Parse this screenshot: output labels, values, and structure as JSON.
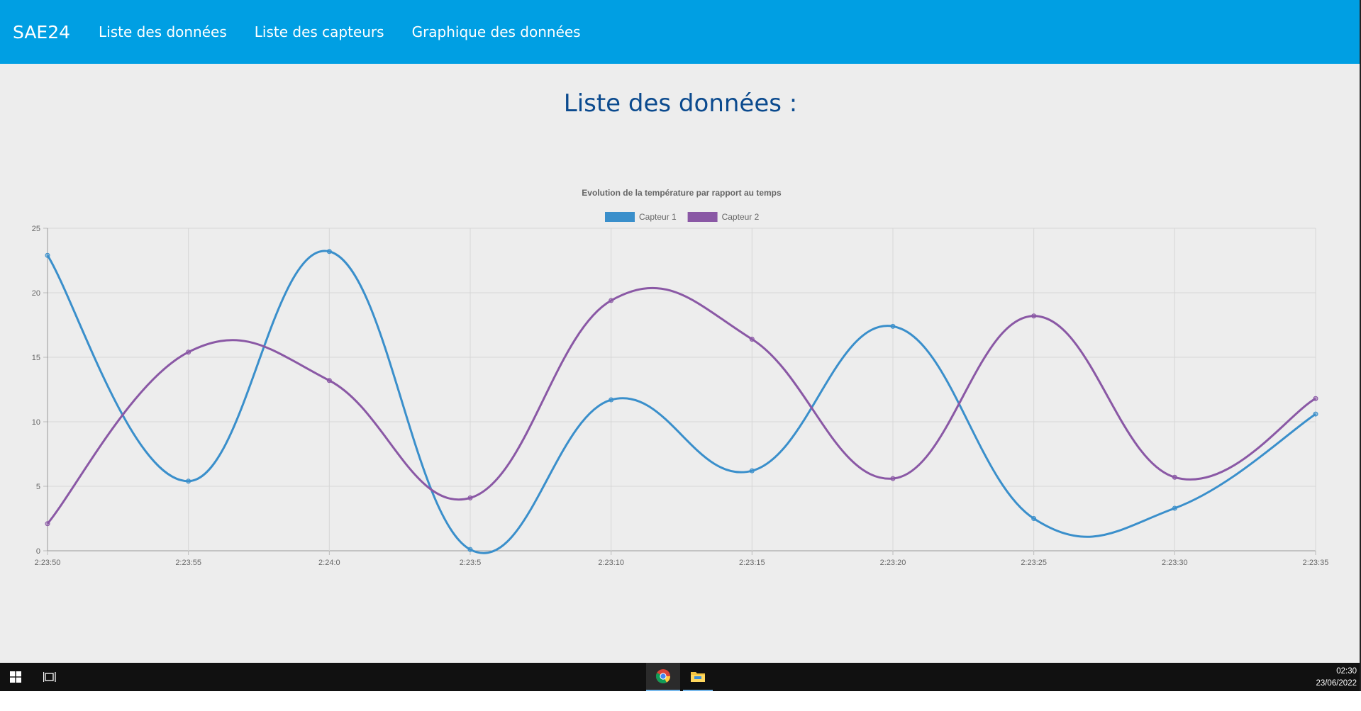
{
  "navbar": {
    "brand": "SAE24",
    "links": [
      "Liste des données",
      "Liste des capteurs",
      "Graphique des données"
    ]
  },
  "page": {
    "title": "Liste des données :"
  },
  "chart_data": {
    "type": "line",
    "title": "Evolution de la température par rapport au temps",
    "categories": [
      "2:23:50",
      "2:23:55",
      "2:24:0",
      "2:23:5",
      "2:23:10",
      "2:23:15",
      "2:23:20",
      "2:23:25",
      "2:23:30",
      "2:23:35"
    ],
    "series": [
      {
        "name": "Capteur 1",
        "color": "#3a8fcb",
        "values": [
          22.9,
          5.4,
          23.2,
          0.1,
          11.7,
          6.2,
          17.4,
          2.5,
          3.3,
          10.6
        ]
      },
      {
        "name": "Capteur 2",
        "color": "#8a58a5",
        "values": [
          2.1,
          15.4,
          13.2,
          4.1,
          19.4,
          16.4,
          5.6,
          18.2,
          5.7,
          11.8
        ]
      }
    ],
    "ylim": [
      0,
      25
    ],
    "yticks": [
      0,
      5,
      10,
      15,
      20,
      25
    ],
    "grid": true,
    "legend": "top-center"
  },
  "taskbar": {
    "icons": [
      "windows-start-icon",
      "task-view-icon",
      "chrome-icon",
      "file-explorer-icon"
    ],
    "clock_time": "02:30",
    "clock_date": "23/06/2022"
  },
  "colors": {
    "navbar": "#009fe3",
    "background": "#ededed",
    "title": "#0b4a8e"
  }
}
